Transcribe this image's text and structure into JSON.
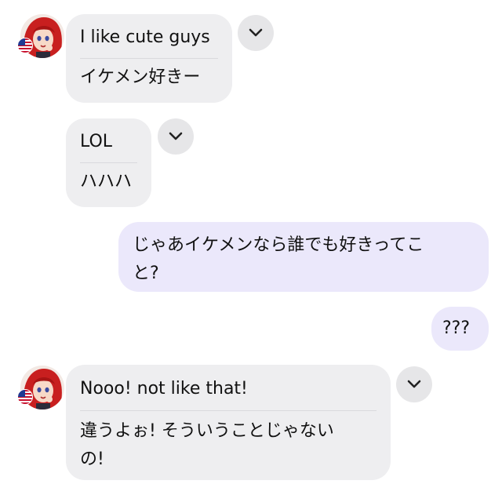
{
  "messages": [
    {
      "side": "incoming",
      "original": "I like cute guys",
      "translation": "イケメン好きー"
    },
    {
      "side": "incoming",
      "original": "LOL",
      "translation": "ハハハ"
    },
    {
      "side": "outgoing",
      "text_line1": "じゃあイケメンなら誰でも好きってこ",
      "text_line2": "と?"
    },
    {
      "side": "outgoing",
      "text": "???"
    },
    {
      "side": "incoming",
      "original": "Nooo!  not like that!",
      "translation_line1": "違うよぉ!  そういうことじゃない",
      "translation_line2": "の!"
    }
  ],
  "icons": {
    "avatar": "avatar-red-hair-girl",
    "flag": "us-flag-icon",
    "chevron": "chevron-down-icon"
  },
  "colors": {
    "incoming_bubble": "#eeeef0",
    "outgoing_bubble": "#ebe8fb",
    "chevron_button": "#e6e6e8",
    "hair": "#c81f1f"
  }
}
